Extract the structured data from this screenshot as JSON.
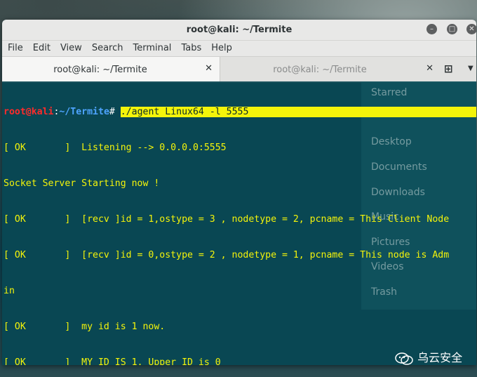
{
  "window": {
    "title": "root@kali: ~/Termite",
    "controls": {
      "minimize": "minimize-icon",
      "maximize": "maximize-icon",
      "close": "close-icon"
    }
  },
  "menu": [
    "File",
    "Edit",
    "View",
    "Search",
    "Terminal",
    "Tabs",
    "Help"
  ],
  "tabs": [
    {
      "label": "root@kali: ~/Termite",
      "close": "✕",
      "active": true
    },
    {
      "label": "root@kali: ~/Termite",
      "close": "✕",
      "active": false
    }
  ],
  "terminal": {
    "prompt": {
      "user": "root@kali",
      "colon": ":",
      "path": "~/Termite",
      "hash": "# "
    },
    "command": "./agent Linux64 -l 5555",
    "output": [
      "[ OK       ]  Listening --> 0.0.0.0:5555",
      "Socket Server Starting now !",
      "[ OK       ]  [recv ]id = 1,ostype = 3 , nodetype = 2, pcname = This Client Node",
      "[ OK       ]  [recv ]id = 0,ostype = 2 , nodetype = 1, pcname = This node is Adm",
      "in",
      "[ OK       ]  my id is 1 now.",
      "[ OK       ]  MY ID IS 1, Upper ID is 0"
    ],
    "colors": {
      "text": "#f4f40a",
      "user": "#ff2b2b",
      "path": "#4ea4ff",
      "background": "#0a4652"
    }
  },
  "background_file_manager": [
    "Starred",
    "Desktop",
    "Documents",
    "Downloads",
    "Music",
    "Pictures",
    "Videos",
    "Trash"
  ],
  "watermark": {
    "text": "乌云安全",
    "icon": "wechat-icon"
  }
}
